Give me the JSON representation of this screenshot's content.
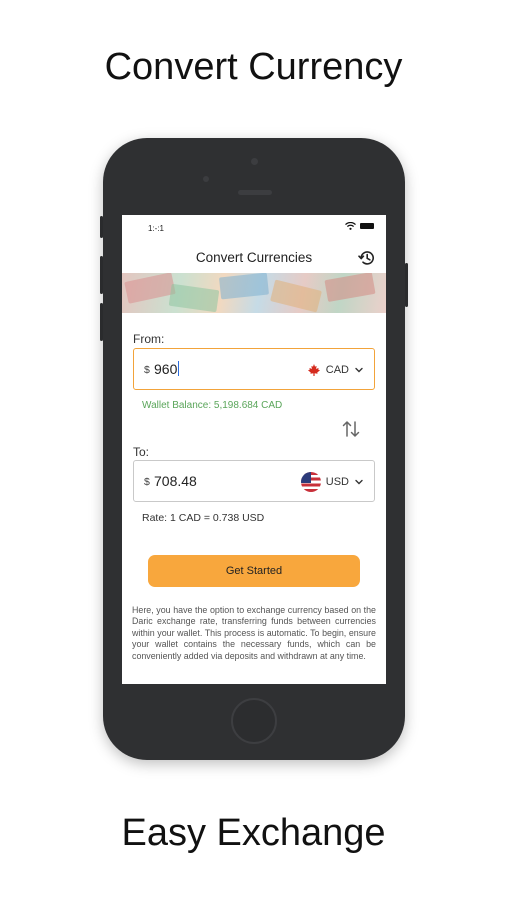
{
  "promo": {
    "top_title": "Convert Currency",
    "bottom_title": "Easy Exchange"
  },
  "status_bar": {
    "time": "1:-:1"
  },
  "nav": {
    "title": "Convert Currencies",
    "history_icon": "history-icon"
  },
  "from": {
    "label": "From:",
    "symbol": "$",
    "amount": "960",
    "currency": "CAD",
    "flag_icon": "maple-leaf-icon"
  },
  "wallet_balance": "Wallet Balance: 5,198.684 CAD",
  "swap_icon": "swap-vertical-icon",
  "to": {
    "label": "To:",
    "symbol": "$",
    "amount": "708.48",
    "currency": "USD",
    "flag_icon": "us-flag-icon"
  },
  "rate": "Rate: 1 CAD = 0.738 USD",
  "cta_label": "Get Started",
  "description": "Here, you have the option to exchange currency based on the Daric exchange rate, transferring funds between currencies within your wallet. This process is automatic. To begin, ensure your wallet contains the necessary funds, which can be conveniently added via deposits and withdrawn at any time.",
  "colors": {
    "accent": "#f8a73d",
    "wallet_text": "#5aa55a",
    "phone_body": "#2f3032"
  }
}
